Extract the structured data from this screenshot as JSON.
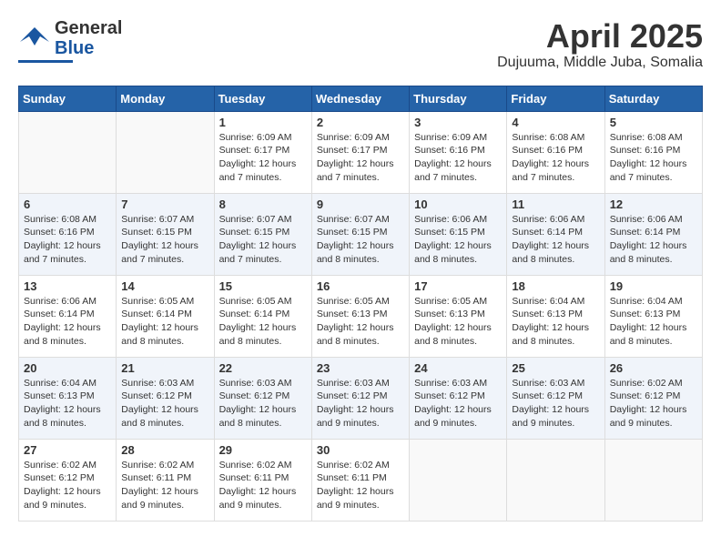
{
  "header": {
    "logo_line1": "General",
    "logo_line2": "Blue",
    "month": "April 2025",
    "location": "Dujuuma, Middle Juba, Somalia"
  },
  "weekdays": [
    "Sunday",
    "Monday",
    "Tuesday",
    "Wednesday",
    "Thursday",
    "Friday",
    "Saturday"
  ],
  "weeks": [
    [
      {
        "day": "",
        "detail": ""
      },
      {
        "day": "",
        "detail": ""
      },
      {
        "day": "1",
        "detail": "Sunrise: 6:09 AM\nSunset: 6:17 PM\nDaylight: 12 hours\nand 7 minutes."
      },
      {
        "day": "2",
        "detail": "Sunrise: 6:09 AM\nSunset: 6:17 PM\nDaylight: 12 hours\nand 7 minutes."
      },
      {
        "day": "3",
        "detail": "Sunrise: 6:09 AM\nSunset: 6:16 PM\nDaylight: 12 hours\nand 7 minutes."
      },
      {
        "day": "4",
        "detail": "Sunrise: 6:08 AM\nSunset: 6:16 PM\nDaylight: 12 hours\nand 7 minutes."
      },
      {
        "day": "5",
        "detail": "Sunrise: 6:08 AM\nSunset: 6:16 PM\nDaylight: 12 hours\nand 7 minutes."
      }
    ],
    [
      {
        "day": "6",
        "detail": "Sunrise: 6:08 AM\nSunset: 6:16 PM\nDaylight: 12 hours\nand 7 minutes."
      },
      {
        "day": "7",
        "detail": "Sunrise: 6:07 AM\nSunset: 6:15 PM\nDaylight: 12 hours\nand 7 minutes."
      },
      {
        "day": "8",
        "detail": "Sunrise: 6:07 AM\nSunset: 6:15 PM\nDaylight: 12 hours\nand 7 minutes."
      },
      {
        "day": "9",
        "detail": "Sunrise: 6:07 AM\nSunset: 6:15 PM\nDaylight: 12 hours\nand 8 minutes."
      },
      {
        "day": "10",
        "detail": "Sunrise: 6:06 AM\nSunset: 6:15 PM\nDaylight: 12 hours\nand 8 minutes."
      },
      {
        "day": "11",
        "detail": "Sunrise: 6:06 AM\nSunset: 6:14 PM\nDaylight: 12 hours\nand 8 minutes."
      },
      {
        "day": "12",
        "detail": "Sunrise: 6:06 AM\nSunset: 6:14 PM\nDaylight: 12 hours\nand 8 minutes."
      }
    ],
    [
      {
        "day": "13",
        "detail": "Sunrise: 6:06 AM\nSunset: 6:14 PM\nDaylight: 12 hours\nand 8 minutes."
      },
      {
        "day": "14",
        "detail": "Sunrise: 6:05 AM\nSunset: 6:14 PM\nDaylight: 12 hours\nand 8 minutes."
      },
      {
        "day": "15",
        "detail": "Sunrise: 6:05 AM\nSunset: 6:14 PM\nDaylight: 12 hours\nand 8 minutes."
      },
      {
        "day": "16",
        "detail": "Sunrise: 6:05 AM\nSunset: 6:13 PM\nDaylight: 12 hours\nand 8 minutes."
      },
      {
        "day": "17",
        "detail": "Sunrise: 6:05 AM\nSunset: 6:13 PM\nDaylight: 12 hours\nand 8 minutes."
      },
      {
        "day": "18",
        "detail": "Sunrise: 6:04 AM\nSunset: 6:13 PM\nDaylight: 12 hours\nand 8 minutes."
      },
      {
        "day": "19",
        "detail": "Sunrise: 6:04 AM\nSunset: 6:13 PM\nDaylight: 12 hours\nand 8 minutes."
      }
    ],
    [
      {
        "day": "20",
        "detail": "Sunrise: 6:04 AM\nSunset: 6:13 PM\nDaylight: 12 hours\nand 8 minutes."
      },
      {
        "day": "21",
        "detail": "Sunrise: 6:03 AM\nSunset: 6:12 PM\nDaylight: 12 hours\nand 8 minutes."
      },
      {
        "day": "22",
        "detail": "Sunrise: 6:03 AM\nSunset: 6:12 PM\nDaylight: 12 hours\nand 8 minutes."
      },
      {
        "day": "23",
        "detail": "Sunrise: 6:03 AM\nSunset: 6:12 PM\nDaylight: 12 hours\nand 9 minutes."
      },
      {
        "day": "24",
        "detail": "Sunrise: 6:03 AM\nSunset: 6:12 PM\nDaylight: 12 hours\nand 9 minutes."
      },
      {
        "day": "25",
        "detail": "Sunrise: 6:03 AM\nSunset: 6:12 PM\nDaylight: 12 hours\nand 9 minutes."
      },
      {
        "day": "26",
        "detail": "Sunrise: 6:02 AM\nSunset: 6:12 PM\nDaylight: 12 hours\nand 9 minutes."
      }
    ],
    [
      {
        "day": "27",
        "detail": "Sunrise: 6:02 AM\nSunset: 6:12 PM\nDaylight: 12 hours\nand 9 minutes."
      },
      {
        "day": "28",
        "detail": "Sunrise: 6:02 AM\nSunset: 6:11 PM\nDaylight: 12 hours\nand 9 minutes."
      },
      {
        "day": "29",
        "detail": "Sunrise: 6:02 AM\nSunset: 6:11 PM\nDaylight: 12 hours\nand 9 minutes."
      },
      {
        "day": "30",
        "detail": "Sunrise: 6:02 AM\nSunset: 6:11 PM\nDaylight: 12 hours\nand 9 minutes."
      },
      {
        "day": "",
        "detail": ""
      },
      {
        "day": "",
        "detail": ""
      },
      {
        "day": "",
        "detail": ""
      }
    ]
  ]
}
